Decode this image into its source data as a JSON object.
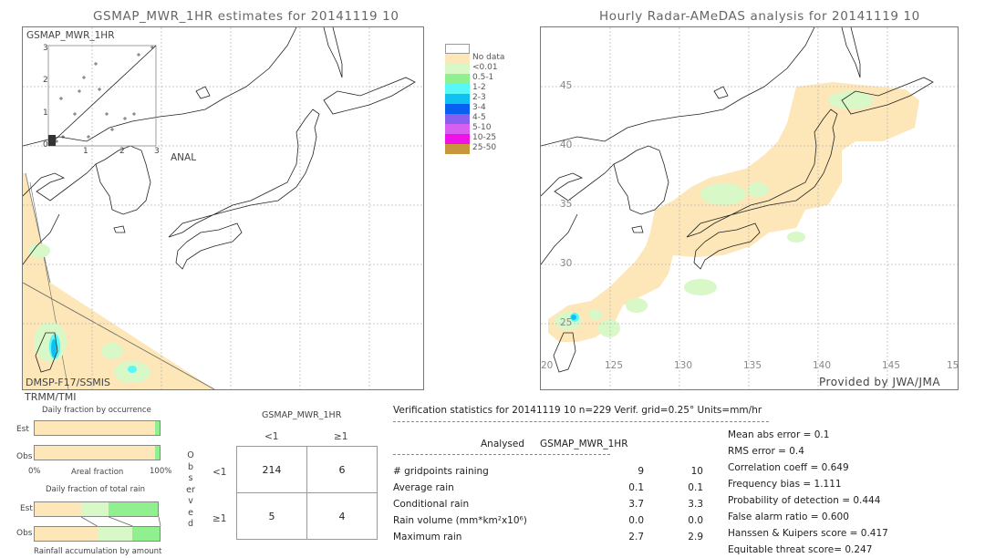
{
  "left_panel": {
    "title": "GSMAP_MWR_1HR estimates for 20141119 10",
    "inset_label": "GSMAP_MWR_1HR",
    "inset_x_label": "ANAL",
    "inset_ticks_y": [
      "3",
      "2",
      "1",
      "0"
    ],
    "inset_ticks_x": [
      "1",
      "2",
      "3"
    ],
    "sensor_label_1": "DMSP-F17/SSMIS",
    "sensor_label_2": "TRMM/TMI"
  },
  "right_panel": {
    "title": "Hourly Radar-AMeDAS analysis for 20141119 10",
    "lat_labels": [
      "45",
      "40",
      "35",
      "30",
      "25",
      "20"
    ],
    "lon_labels": [
      "125",
      "130",
      "135",
      "140",
      "145",
      "15"
    ],
    "lon_first": "20",
    "credit": "Provided by JWA/JMA"
  },
  "legend": {
    "items": [
      {
        "label": "",
        "color": "#ffffff"
      },
      {
        "label": "No data",
        "color": "#fde6b8"
      },
      {
        "label": "<0.01",
        "color": "#d8f8c8"
      },
      {
        "label": "0.5-1",
        "color": "#90f090"
      },
      {
        "label": "1-2",
        "color": "#58f8f8"
      },
      {
        "label": "2-3",
        "color": "#10c0f0"
      },
      {
        "label": "3-4",
        "color": "#0860f0"
      },
      {
        "label": "4-5",
        "color": "#8860f0"
      },
      {
        "label": "5-10",
        "color": "#d860f0"
      },
      {
        "label": "10-25",
        "color": "#f010e8"
      },
      {
        "label": "25-50",
        "color": "#c8963c"
      }
    ]
  },
  "occurrence": {
    "title": "Daily fraction by occurrence",
    "est_label": "Est",
    "obs_label": "Obs",
    "axis_left": "0%",
    "axis_mid": "Areal fraction",
    "axis_right": "100%",
    "est_fractions": {
      "no_rain": 0.961,
      "rain": 0.039
    },
    "obs_fractions": {
      "no_rain": 0.961,
      "rain": 0.039
    }
  },
  "total_rain": {
    "title": "Daily fraction of total rain",
    "est_label": "Est",
    "obs_label": "Obs",
    "footer": "Rainfall accumulation by amount",
    "est_fractions": [
      0.38,
      0.22,
      0.4
    ],
    "obs_fractions": [
      0.5,
      0.28,
      0.22
    ]
  },
  "contingency": {
    "col_title": "GSMAP_MWR_1HR",
    "row_title": "Observed",
    "col_headers": [
      "<1",
      "≥1"
    ],
    "row_headers": [
      "<1",
      "≥1"
    ],
    "cells": [
      [
        "214",
        "6"
      ],
      [
        "5",
        "4"
      ]
    ]
  },
  "verification": {
    "header": "Verification statistics for 20141119 10   n=229   Verif. grid=0.25°   Units=mm/hr",
    "col_analysed": "Analysed",
    "col_model": "GSMAP_MWR_1HR",
    "rows": [
      {
        "label": "# gridpoints raining",
        "analysed": "9",
        "model": "10"
      },
      {
        "label": "Average rain",
        "analysed": "0.1",
        "model": "0.1"
      },
      {
        "label": "Conditional rain",
        "analysed": "3.7",
        "model": "3.3"
      },
      {
        "label": "Rain volume (mm*km²x10⁶)",
        "analysed": "0.0",
        "model": "0.0"
      },
      {
        "label": "Maximum rain",
        "analysed": "2.7",
        "model": "2.9"
      }
    ],
    "scores": [
      "Mean abs error = 0.1",
      "RMS error = 0.4",
      "Correlation coeff = 0.649",
      "Frequency bias = 1.111",
      "Probability of detection = 0.444",
      "False alarm ratio = 0.600",
      "Hanssen & Kuipers score = 0.417",
      "Equitable threat score= 0.247"
    ]
  }
}
